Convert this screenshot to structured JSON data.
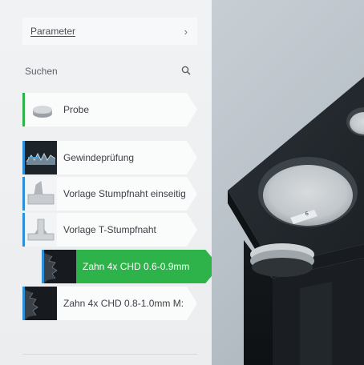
{
  "panel": {
    "parameter_label": "Parameter",
    "parameter_chevron": "›",
    "search_label": "Suchen"
  },
  "items": [
    {
      "label": "Probe",
      "thumb": "disk-icon"
    },
    {
      "label": "Gewindeprüfung",
      "thumb": "thread-thumbnail"
    },
    {
      "label": "Vorlage Stumpfnaht einseitig",
      "thumb": "weld-thumbnail"
    },
    {
      "label": "Vorlage T-Stumpfnaht",
      "thumb": "weld-thumbnail"
    },
    {
      "label": "Zahn 4x CHD 0.6-0.9mm",
      "thumb": "gear-thumbnail",
      "active": true
    },
    {
      "label": "Zahn 4x CHD 0.8-1.0mm M:",
      "thumb": "gear-thumbnail"
    }
  ],
  "viewport": {
    "slot_label": "6"
  },
  "colors": {
    "accent_green": "#2db34a",
    "accent_blue": "#2e8fd6",
    "holder_dark": "#1d2226"
  }
}
